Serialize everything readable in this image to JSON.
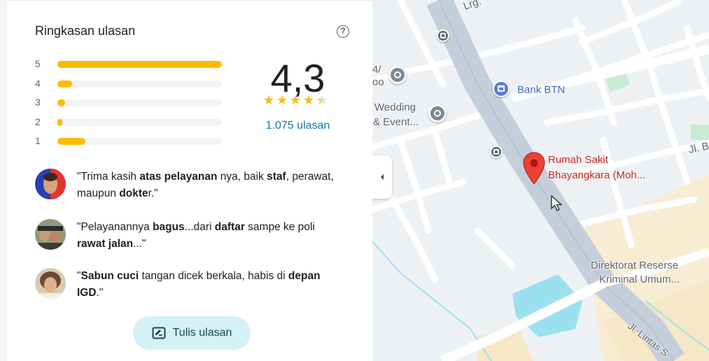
{
  "summary": {
    "title": "Ringkasan ulasan",
    "help_icon": "help-icon",
    "average": "4,3",
    "average_value": 4.3,
    "review_count": "1.075 ulasan",
    "star_color": "#fbbc04",
    "histogram": [
      {
        "stars": "5",
        "fraction": 1.0
      },
      {
        "stars": "4",
        "fraction": 0.09
      },
      {
        "stars": "3",
        "fraction": 0.045
      },
      {
        "stars": "2",
        "fraction": 0.03
      },
      {
        "stars": "1",
        "fraction": 0.17
      }
    ]
  },
  "snippets": [
    {
      "avatar_icon": "user-avatar",
      "parts": [
        {
          "t": "\"Trima kasih ",
          "b": false
        },
        {
          "t": "atas pelayanan",
          "b": true
        },
        {
          "t": " nya, baik ",
          "b": false
        },
        {
          "t": "staf",
          "b": true
        },
        {
          "t": ", perawat, maupun ",
          "b": false
        },
        {
          "t": "dokte",
          "b": true
        },
        {
          "t": "r.\"",
          "b": false
        }
      ]
    },
    {
      "avatar_icon": "user-avatar",
      "parts": [
        {
          "t": "\"Pelayanannya ",
          "b": false
        },
        {
          "t": "bagus",
          "b": true
        },
        {
          "t": "...dari ",
          "b": false
        },
        {
          "t": "daftar",
          "b": true
        },
        {
          "t": " sampe ke poli ",
          "b": false
        },
        {
          "t": "rawat jalan",
          "b": true
        },
        {
          "t": "...\"",
          "b": false
        }
      ]
    },
    {
      "avatar_icon": "user-avatar",
      "parts": [
        {
          "t": "\"",
          "b": false
        },
        {
          "t": "Sabun cuci",
          "b": true
        },
        {
          "t": " tangan dicek berkala, habis di ",
          "b": false
        },
        {
          "t": "depan IGD",
          "b": true
        },
        {
          "t": ".\"",
          "b": false
        }
      ]
    }
  ],
  "write_review": {
    "label": "Tulis ulasan",
    "icon": "edit-review-icon"
  },
  "map": {
    "labels": {
      "top_road": "Lrg.",
      "partial_left": "4/",
      "partial_left2": "oo",
      "bank": "Bank BTN",
      "wedding_1": "Wedding",
      "wedding_2": "& Event...",
      "hospital_1": "Rumah Sakit",
      "hospital_2": "Bhayangkara (Moh...",
      "jl_right": "Jl. B",
      "directorate_1": "Direktorat Reserse",
      "directorate_2": "Kriminal Umum...",
      "jl_lintas": "Jl. Lintas S"
    },
    "pin_color": "#ea4335"
  }
}
